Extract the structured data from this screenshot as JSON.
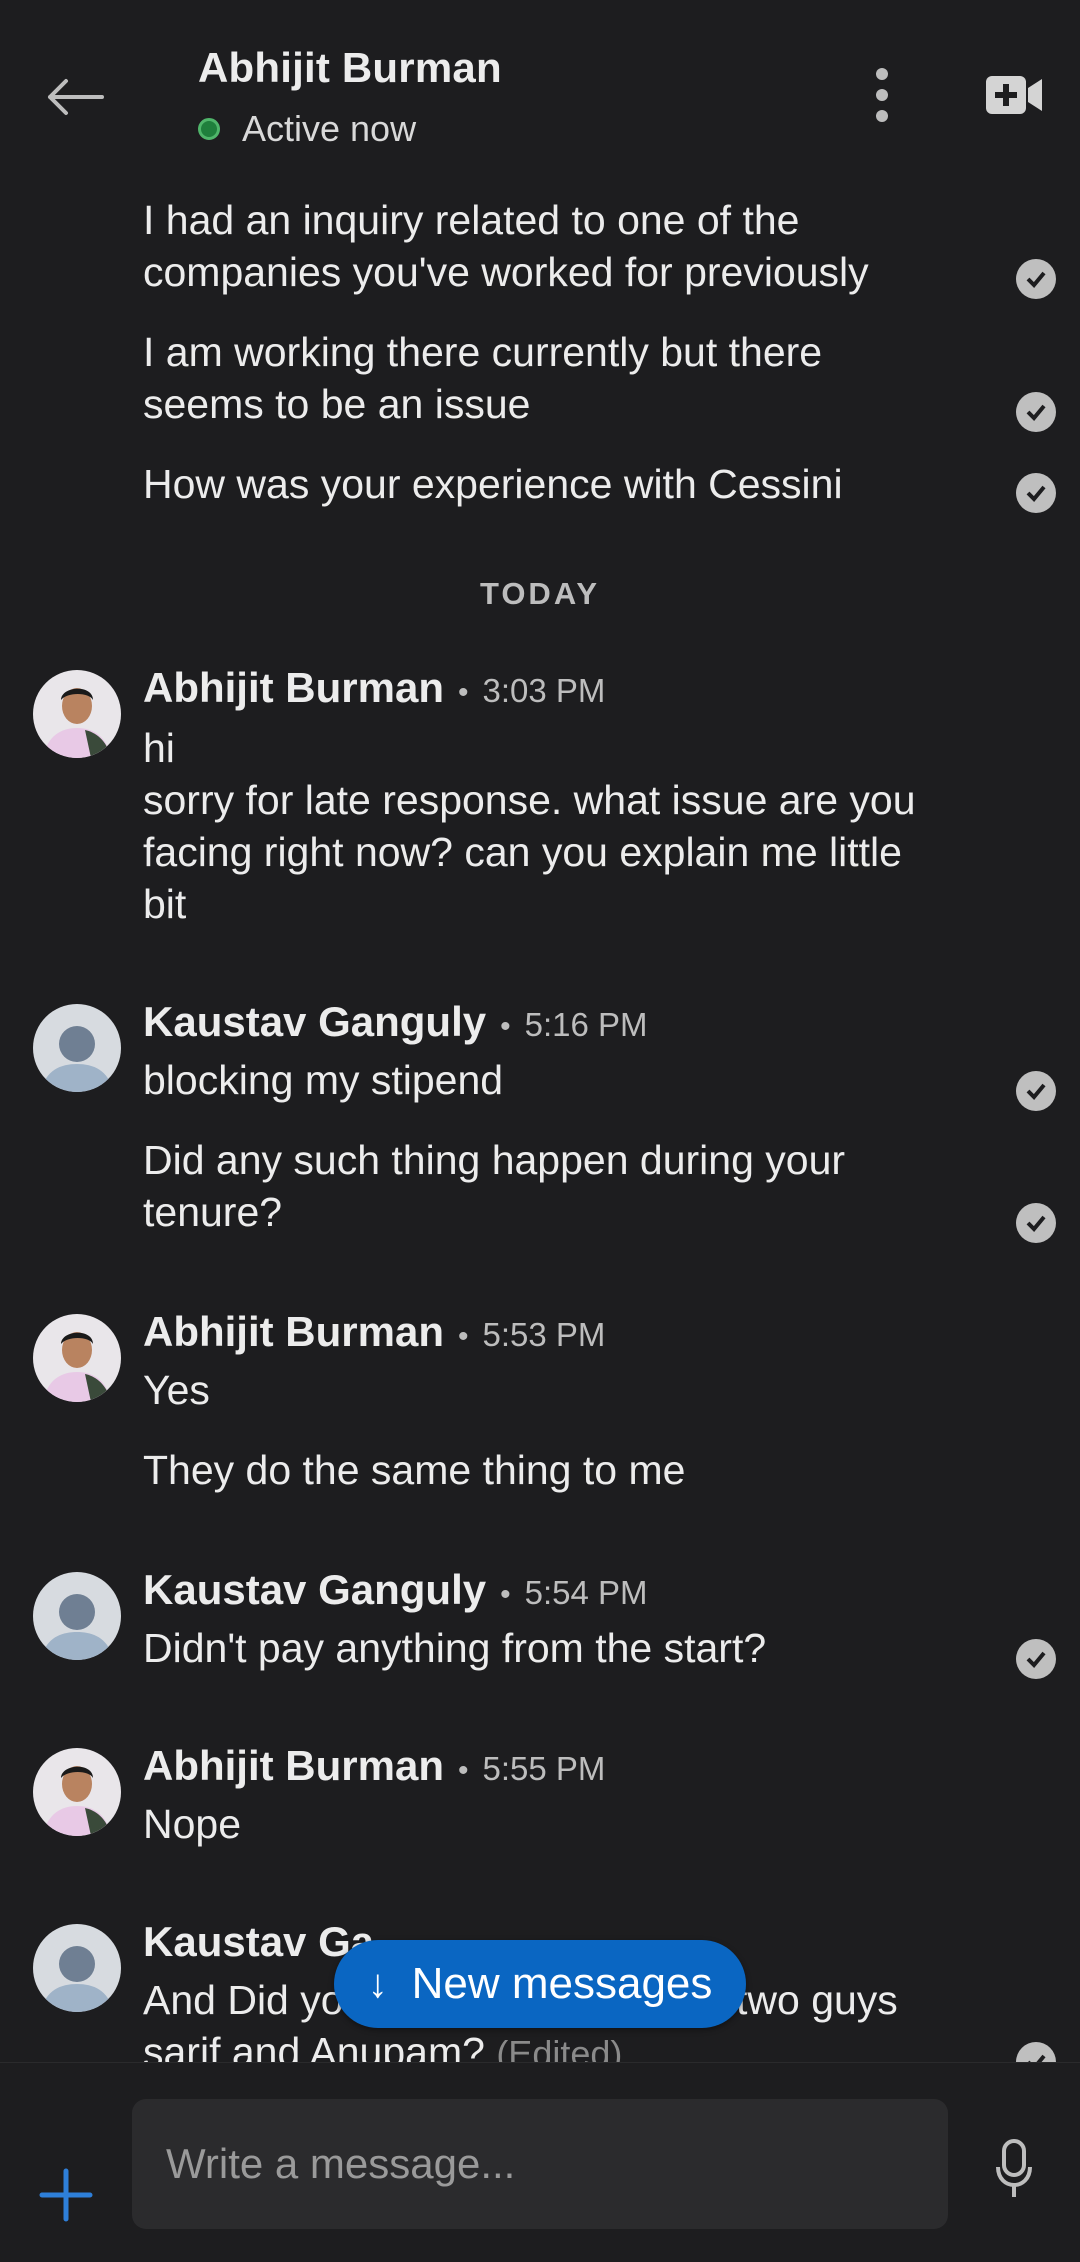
{
  "header": {
    "title": "Abhijit Burman",
    "status": "Active now"
  },
  "earlier_messages": [
    {
      "line1": "I had an inquiry related to one of the",
      "line2": "companies you've worked for previously"
    },
    {
      "line1": "I am working there currently but there",
      "line2": "seems to be an issue"
    },
    {
      "line1": "How was your experience with Cessini",
      "line2": ""
    }
  ],
  "day_divider": "TODAY",
  "groups": [
    {
      "sender": "Abhijit Burman",
      "time": "3:03 PM",
      "lines": [
        "hi",
        "sorry for late response. what issue are you",
        "facing right now? can you explain me little",
        "bit"
      ]
    },
    {
      "sender": "Kaustav Ganguly",
      "time": "5:16 PM",
      "lines": [
        "blocking my stipend",
        "Did any such thing happen during your",
        "tenure?"
      ]
    },
    {
      "sender": "Abhijit Burman",
      "time": "5:53 PM",
      "lines": [
        "Yes",
        "They do the same thing to me"
      ]
    },
    {
      "sender": "Kaustav Ganguly",
      "time": "5:54 PM",
      "lines": [
        "Didn't pay anything from the start?"
      ]
    },
    {
      "sender": "Abhijit Burman",
      "time": "5:55 PM",
      "lines": [
        "Nope"
      ]
    },
    {
      "sender": "Kaustav Ga",
      "time": "",
      "lines": [
        "And Did yo",
        "two guys",
        "sarif and Anupam?"
      ],
      "edited": "(Edited)"
    }
  ],
  "new_messages_label": "New messages",
  "composer": {
    "placeholder": "Write a message..."
  },
  "colors": {
    "background": "#1d1d1f",
    "accent": "#0a66c2",
    "online": "#1f7f3c"
  }
}
